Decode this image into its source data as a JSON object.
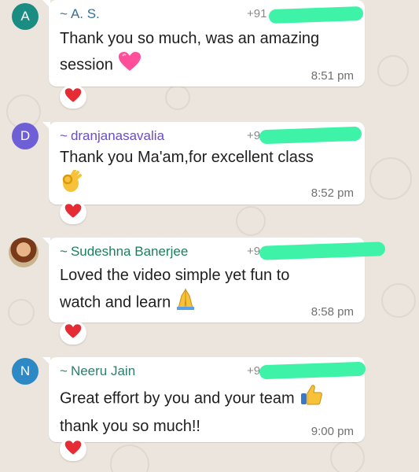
{
  "messages": [
    {
      "avatar_letter": "A",
      "avatar_color": "#1a8c82",
      "sender": "A. S.",
      "sender_color": "#3a6f97",
      "phone_prefix": "+91",
      "text_lines": [
        "Thank you so much, was an amazing",
        "session"
      ],
      "emoji": "pink-heart-icon",
      "time": "8:51 pm",
      "reaction": "red-heart-icon"
    },
    {
      "avatar_letter": "D",
      "avatar_color": "#6e5fd6",
      "sender": "dranjanasavalia",
      "sender_color": "#6c4ad8",
      "phone_prefix": "+9",
      "text_lines": [
        "Thank you Ma'am,for excellent class"
      ],
      "emoji": "ok-hand-icon",
      "time": "8:52 pm",
      "reaction": "red-heart-icon"
    },
    {
      "avatar_letter": "",
      "avatar_color": "#7a3a1a",
      "sender": "Sudeshna Banerjee",
      "sender_color": "#1b7f5c",
      "phone_prefix": "+9",
      "text_lines": [
        "Loved the video simple yet fun to",
        "watch and learn"
      ],
      "emoji": "folded-hands-icon",
      "time": "8:58 pm",
      "reaction": "red-heart-icon"
    },
    {
      "avatar_letter": "N",
      "avatar_color": "#2d88c6",
      "sender": "Neeru Jain",
      "sender_color": "#2f7d6d",
      "phone_prefix": "+9",
      "text_lines": [
        "Great effort by you and your team",
        "thank you so much!!"
      ],
      "emoji": "thumbs-up-icon",
      "time": "9:00 pm",
      "reaction": "red-heart-icon"
    }
  ]
}
